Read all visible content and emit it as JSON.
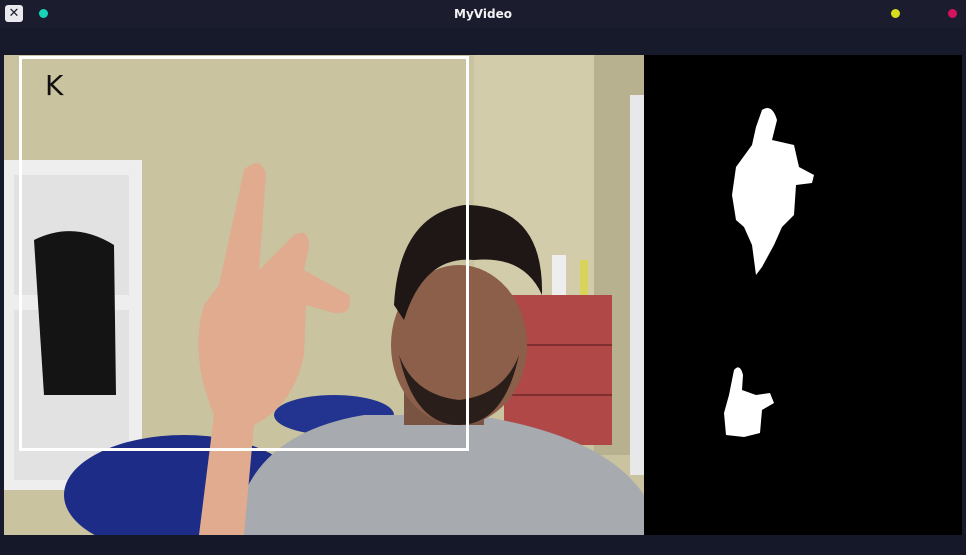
{
  "window": {
    "title": "MyVideo",
    "app_icon": "x-window-icon",
    "dots": {
      "left": "#16d4b8",
      "middle": "#d7dd1a",
      "right": "#d4135c"
    }
  },
  "video": {
    "predicted_letter": "K",
    "roi_box_color": "#ffffff"
  },
  "mask": {
    "background": "#000000",
    "foreground": "#ffffff"
  }
}
